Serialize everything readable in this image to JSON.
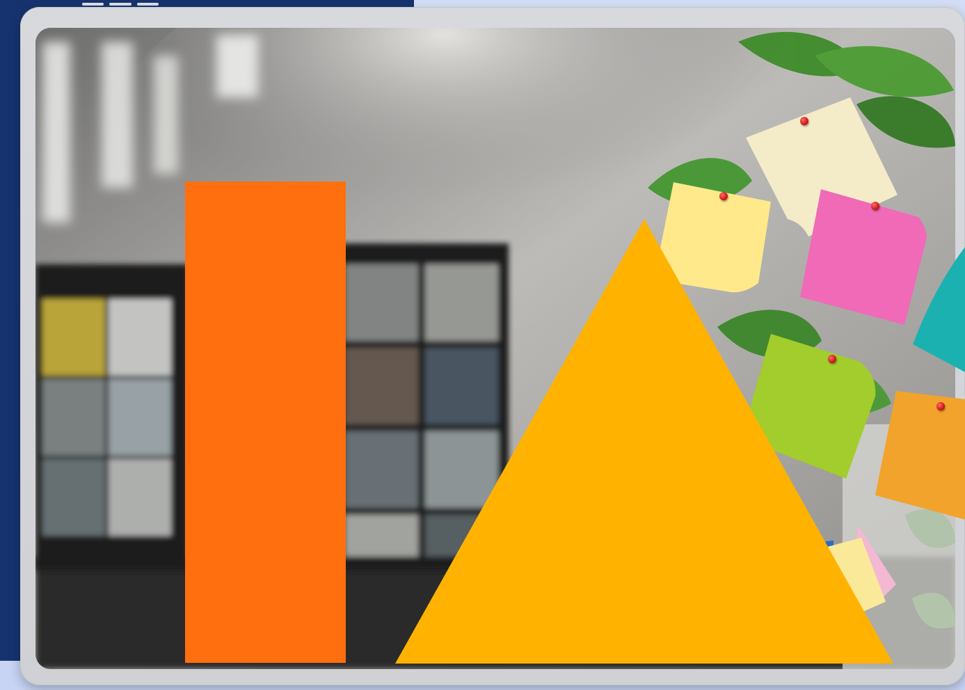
{
  "scene": {
    "background_colors": {
      "left_panel": "#17336f",
      "right_panel": "#d3def6",
      "bottom_strip": "#c7d4f3"
    },
    "frame_color": "#d5d6d9",
    "photo_subject_icon": "video-call-laptop-image",
    "shapes": {
      "bar_color": "#ff6f0f",
      "triangle_color": "#ffb300"
    },
    "sticky_notes": [
      {
        "name": "cream-note",
        "color": "#f4ecc8"
      },
      {
        "name": "yellow-note",
        "color": "#ffe98a"
      },
      {
        "name": "pink-note",
        "color": "#f06ab8"
      },
      {
        "name": "teal-note",
        "color": "#1cb1b1"
      },
      {
        "name": "green-note",
        "color": "#a2cd2c"
      },
      {
        "name": "orange-note",
        "color": "#f2a32b"
      },
      {
        "name": "small-yellow-note",
        "color": "#fbe99a"
      }
    ]
  }
}
